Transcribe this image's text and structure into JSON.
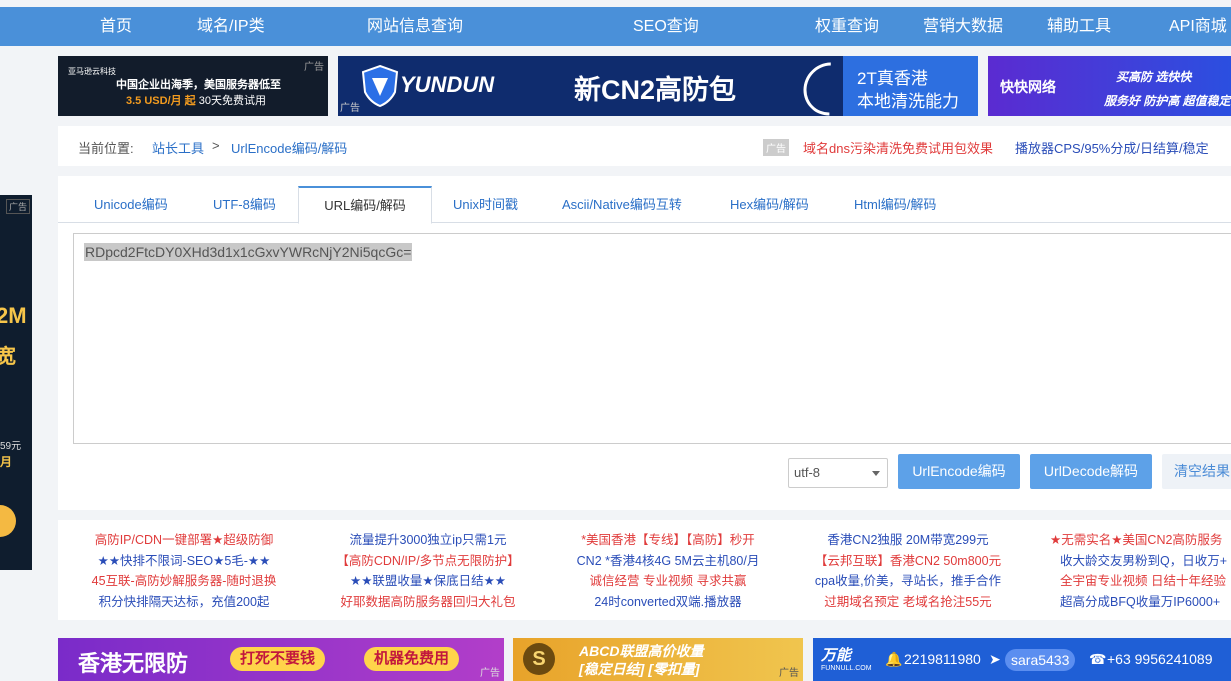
{
  "nav": {
    "items": [
      "首页",
      "域名/IP类",
      "网站信息查询",
      "SEO查询",
      "权重查询",
      "营销大数据",
      "辅助工具",
      "API商城"
    ]
  },
  "ad_label": "广告",
  "left_ad": {
    "big1": "2M",
    "big2": "宽",
    "small1": "59元",
    "small2": "月"
  },
  "banners": {
    "b1": {
      "brand": "亚马逊云科技",
      "line1": "中国企业出海季，美国服务器低至",
      "price": "3.5 USD/月 起",
      "rest": "30天免费试用"
    },
    "b2": {
      "logo": "YUNDUN",
      "headline": "新CN2高防包",
      "box1": "2T真香港",
      "box2": "本地清洗能力"
    },
    "b3": {
      "logo": "快快网络",
      "r1": "买高防 选快快",
      "r2": "服务好 防护高 超值稳定"
    }
  },
  "breadcrumb": {
    "prefix": "当前位置:",
    "link1": "站长工具",
    "sep": ">",
    "link2": "UrlEncode编码/解码",
    "ad1": "域名dns污染清洗免费试用包效果",
    "ad2": "播放器CPS/95%分成/日结算/稳定"
  },
  "tabs": [
    "Unicode编码",
    "UTF-8编码",
    "URL编码/解码",
    "Unix时间戳",
    "Ascii/Native编码互转",
    "Hex编码/解码",
    "Html编码/解码"
  ],
  "active_tab": "URL编码/解码",
  "editor": {
    "value": "RDpcd2FtcDY0XHd3d1x1cGxvYWRcNjY2Ni5qcGc="
  },
  "charset": {
    "selected": "utf-8"
  },
  "buttons": {
    "encode": "UrlEncode编码",
    "decode": "UrlDecode解码",
    "clear": "清空结果"
  },
  "text_ads": [
    [
      "高防IP/CDN一键部署★超级防御",
      "★★快排不限词-SEO★5毛-★★",
      "45互联-高防妙解服务器-随时退换",
      "积分快排隔天达标，充值200起"
    ],
    [
      "流量提升3000独立ip只需1元",
      "【高防CDN/IP/多节点无限防护】",
      "★★联盟收量★保底日结★★",
      "好耶数据高防服务器回归大礼包"
    ],
    [
      "*美国香港【专线】【高防】秒开",
      "CN2 *香港4核4G 5M云主机80/月",
      "诚信经营 专业视频 寻求共赢",
      "24时converted双端.播放器"
    ],
    [
      "香港CN2独服 20M带宽299元",
      "【云邦互联】香港CN2 50m800元",
      "cpa收量,价美，寻站长，推手合作",
      "过期域名预定 老域名抢注55元"
    ],
    [
      "★无需实名★美国CN2高防服务",
      "收大龄交友男粉到Q，日收万+",
      "全宇宙专业视频 日结十年经验",
      "超高分成BFQ收量万IP6000+"
    ]
  ],
  "bottom_banners": {
    "bb1": {
      "title": "香港无限防",
      "pill1": "打死不要钱",
      "pill2": "机器免费用"
    },
    "bb2": {
      "coin": "S",
      "l1": "ABCD联盟高价收量",
      "l2": "[稳定日结] [零扣量]"
    },
    "bb3": {
      "logo": "万能",
      "logo_sub": "FUNNULL.COM",
      "qq": "2219811980",
      "tg": "sara5433",
      "phone": "+63 9956241089"
    }
  }
}
